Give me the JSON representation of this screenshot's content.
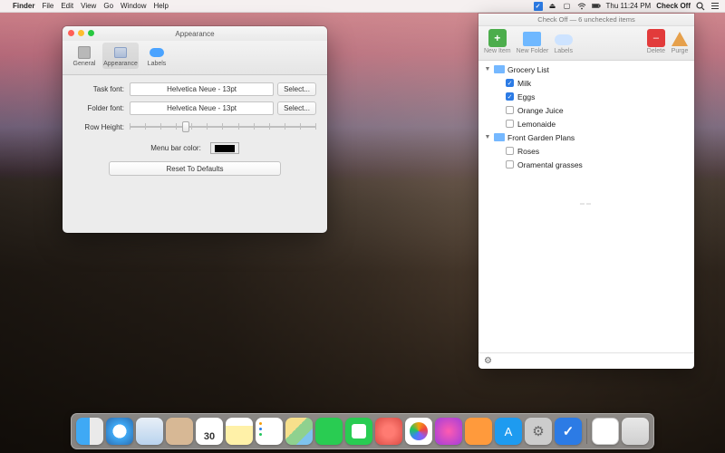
{
  "menubar": {
    "app": "Finder",
    "items": [
      "File",
      "Edit",
      "View",
      "Go",
      "Window",
      "Help"
    ],
    "clock": "Thu 11:24 PM",
    "right_app": "Check Off"
  },
  "prefs": {
    "title": "Appearance",
    "tabs": {
      "general": "General",
      "appearance": "Appearance",
      "labels": "Labels"
    },
    "task_font_label": "Task font:",
    "task_font_value": "Helvetica Neue - 13pt",
    "folder_font_label": "Folder font:",
    "folder_font_value": "Helvetica Neue - 13pt",
    "select_label": "Select...",
    "row_height_label": "Row Height:",
    "menu_bar_color_label": "Menu bar color:",
    "menu_bar_color": "#000000",
    "reset_label": "Reset To Defaults"
  },
  "panel": {
    "title": "Check Off — 6 unchecked items",
    "toolbar": {
      "new_item": "New Item",
      "new_folder": "New Folder",
      "labels": "Labels",
      "delete": "Delete",
      "purge": "Purge"
    },
    "folders": [
      {
        "name": "Grocery List",
        "items": [
          {
            "label": "Milk",
            "checked": true
          },
          {
            "label": "Eggs",
            "checked": true
          },
          {
            "label": "Orange Juice",
            "checked": false
          },
          {
            "label": "Lemonaide",
            "checked": false
          }
        ]
      },
      {
        "name": "Front Garden Plans",
        "items": [
          {
            "label": "Roses",
            "checked": false
          },
          {
            "label": "Oramental grasses",
            "checked": false
          }
        ]
      }
    ]
  },
  "calendar_day": "30"
}
